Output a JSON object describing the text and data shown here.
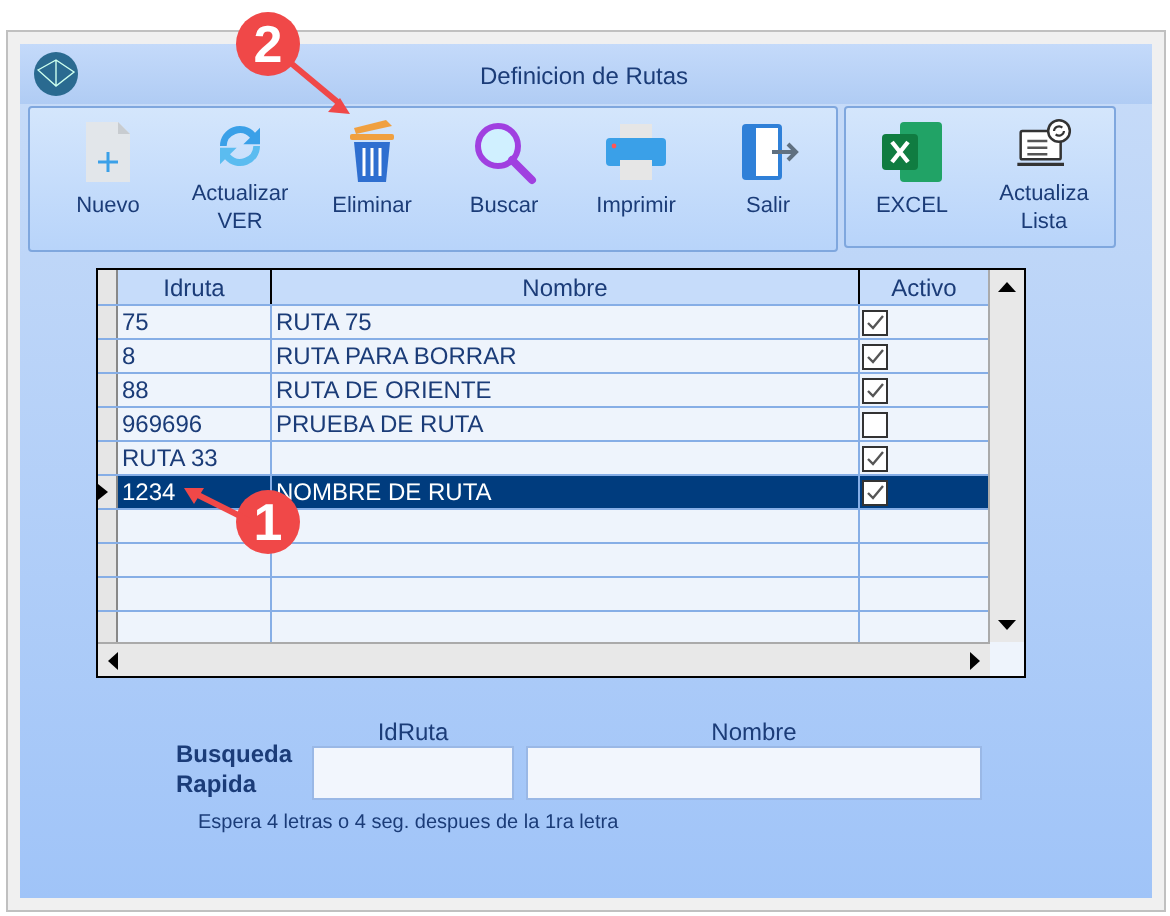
{
  "window": {
    "title": "Definicion de Rutas"
  },
  "toolbar": [
    {
      "kind": "new",
      "label": "Nuevo"
    },
    {
      "kind": "refresh",
      "label": "Actualizar VER"
    },
    {
      "kind": "delete",
      "label": "Eliminar"
    },
    {
      "kind": "search",
      "label": "Buscar"
    },
    {
      "kind": "print",
      "label": "Imprimir"
    },
    {
      "kind": "exit",
      "label": "Salir"
    }
  ],
  "toolbar_right": [
    {
      "kind": "excel",
      "label": "EXCEL"
    },
    {
      "kind": "update_list",
      "label": "Actualiza Lista"
    }
  ],
  "table": {
    "columns": [
      "Idruta",
      "Nombre",
      "Activo"
    ],
    "rows": [
      {
        "idruta": "75",
        "nombre": "RUTA 75",
        "activo": true,
        "selected": false
      },
      {
        "idruta": "8",
        "nombre": "RUTA PARA BORRAR",
        "activo": true,
        "selected": false
      },
      {
        "idruta": "88",
        "nombre": "RUTA DE ORIENTE",
        "activo": true,
        "selected": false
      },
      {
        "idruta": "969696",
        "nombre": "PRUEBA DE RUTA",
        "activo": false,
        "selected": false
      },
      {
        "idruta": "RUTA 33",
        "activo": true,
        "selected": false
      },
      {
        "idruta": "1234",
        "nombre": "NOMBRE DE RUTA",
        "activo": true,
        "selected": true
      }
    ]
  },
  "quick_search": {
    "label": "Busqueda Rapida",
    "fields": [
      "IdRuta",
      "Nombre"
    ],
    "hint": "Espera 4 letras o 4 seg. despues de la 1ra letra"
  },
  "annotations": [
    "2",
    "1"
  ]
}
